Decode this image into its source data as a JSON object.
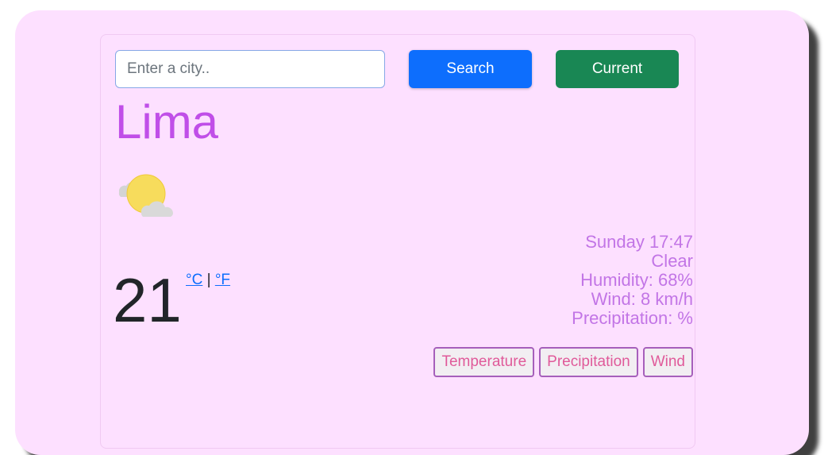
{
  "search": {
    "placeholder": "Enter a city..",
    "value": "",
    "search_label": "Search",
    "current_label": "Current"
  },
  "city": "Lima",
  "weather": {
    "icon": "sun-behind-clouds-icon",
    "temperature": "21",
    "unit_celsius": "°C",
    "unit_separator": "|",
    "unit_fahrenheit": "°F",
    "datetime": "Sunday 17:47",
    "description": "Clear",
    "humidity": "Humidity: 68%",
    "wind": "Wind: 8 km/h",
    "precipitation": "Precipitation: %"
  },
  "tabs": {
    "temperature": "Temperature",
    "precipitation": "Precipitation",
    "wind": "Wind"
  },
  "colors": {
    "background": "#fde0ff",
    "city": "#c04ee8",
    "details": "#c275e6",
    "search_button": "#0d6efd",
    "current_button": "#198754",
    "tab_text": "#e05a9a",
    "tab_border": "#a65fbb"
  }
}
